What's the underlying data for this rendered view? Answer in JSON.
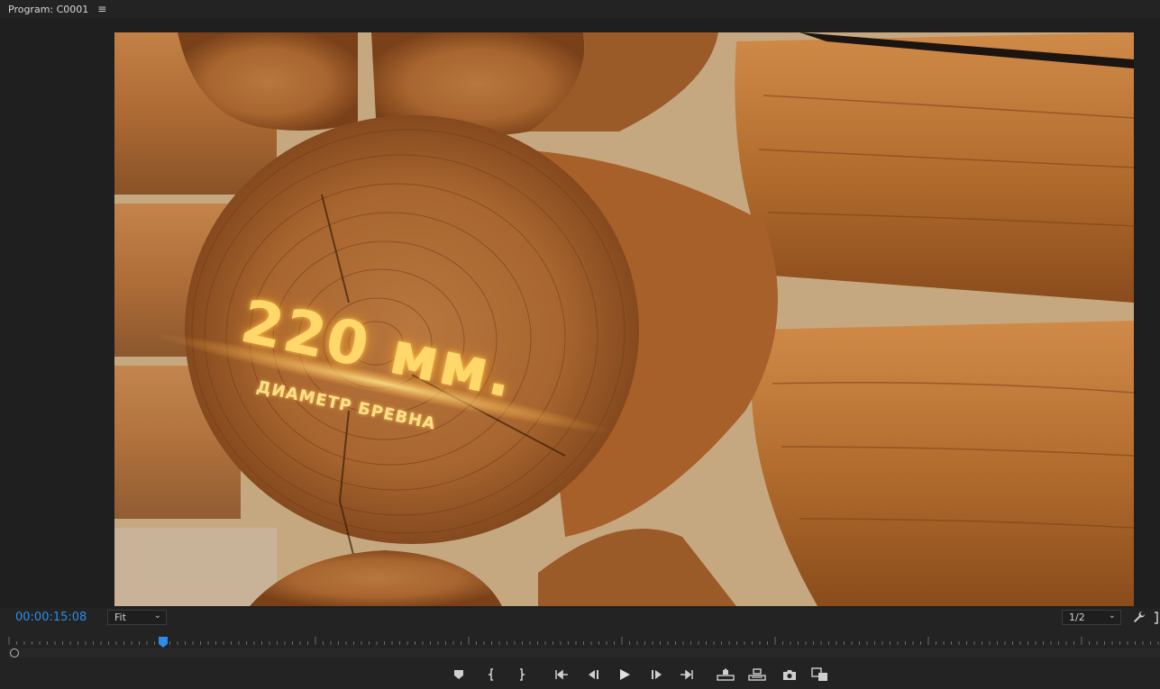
{
  "panel": {
    "title": "Program: C0001",
    "menu_icon": "hamburger-icon"
  },
  "video": {
    "overlay_main": "220 мм.",
    "overlay_sub": "ДИАМЕТР БРЕВНА"
  },
  "controls": {
    "timecode": "00:00:15:08",
    "timecode_color": "#2d8ceb",
    "zoom_value": "Fit",
    "resolution_value": "1/2",
    "settings_icon": "wrench-icon",
    "fit_icon": "bracket-icon"
  },
  "transport": {
    "buttons": [
      {
        "name": "add-marker-button",
        "icon": "marker-icon"
      },
      {
        "name": "mark-in-button",
        "icon": "mark-in-icon"
      },
      {
        "name": "mark-out-button",
        "icon": "mark-out-icon"
      },
      {
        "name": "go-to-in-button",
        "icon": "go-to-in-icon"
      },
      {
        "name": "step-back-button",
        "icon": "step-back-icon"
      },
      {
        "name": "play-button",
        "icon": "play-icon"
      },
      {
        "name": "step-forward-button",
        "icon": "step-forward-icon"
      },
      {
        "name": "go-to-out-button",
        "icon": "go-to-out-icon"
      },
      {
        "name": "lift-button",
        "icon": "lift-icon"
      },
      {
        "name": "extract-button",
        "icon": "extract-icon"
      },
      {
        "name": "export-frame-button",
        "icon": "camera-icon"
      },
      {
        "name": "comparison-view-button",
        "icon": "comparison-view-icon"
      }
    ]
  },
  "colors": {
    "panel_bg": "#232323",
    "accent_blue": "#2d8ceb",
    "playhead": "#2d8ceb"
  }
}
